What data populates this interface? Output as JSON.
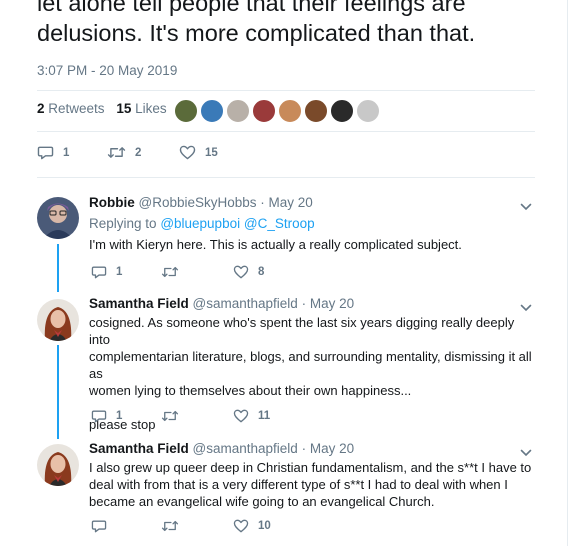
{
  "main_tweet": {
    "text_lines": [
      "let alone tell people that their feelings are",
      "delusions. It's more complicated than that."
    ],
    "timestamp": "3:07 PM - 20 May 2019",
    "retweets_count": "2",
    "retweets_label": "Retweets",
    "likes_count": "15",
    "likes_label": "Likes",
    "liker_avatar_colors": [
      "#5b6b3a",
      "#3a7ab8",
      "#b8b0a8",
      "#9a3a3a",
      "#c88a5a",
      "#7a4a2a",
      "#2a2a2a",
      "#c8c8c8"
    ],
    "actions": {
      "replies": "1",
      "retweets": "2",
      "likes": "15"
    }
  },
  "replies": [
    {
      "name": "Robbie",
      "handle": "@RobbieSkyHobbs",
      "date": "· May 20",
      "replying_prefix": "Replying to",
      "replying_to_1": "@bluepupboi",
      "replying_to_2": "@C_Stroop",
      "text_lines": [
        "I'm with Kieryn here. This is actually a really complicated subject."
      ],
      "actions": {
        "replies": "1",
        "retweets": "",
        "likes": "8"
      }
    },
    {
      "name": "Samantha Field",
      "handle": "@samanthapfield",
      "date": "· May 20",
      "text_lines": [
        "cosigned. As someone who's spent the last six years digging really deeply into",
        "complementarian literature, blogs, and surrounding mentality, dismissing it all as",
        "women lying to themselves about their own happiness...",
        "",
        "please stop"
      ],
      "actions": {
        "replies": "1",
        "retweets": "",
        "likes": "11"
      }
    },
    {
      "name": "Samantha Field",
      "handle": "@samanthapfield",
      "date": "· May 20",
      "text_lines": [
        "I also grew up queer deep in Christian fundamentalism, and the s**t I have to",
        "deal with from that is a very different type of s**t I had to deal with when I",
        "became an evangelical wife going to an evangelical Church."
      ],
      "actions": {
        "replies": "",
        "retweets": "",
        "likes": "10"
      }
    }
  ],
  "colors": {
    "accent": "#1da1f2",
    "muted": "#657786",
    "text": "#14171a",
    "divider": "#e6ecf0"
  },
  "icons": {
    "reply": "reply-icon",
    "retweet": "retweet-icon",
    "like": "heart-icon",
    "more": "chevron-down-icon"
  }
}
